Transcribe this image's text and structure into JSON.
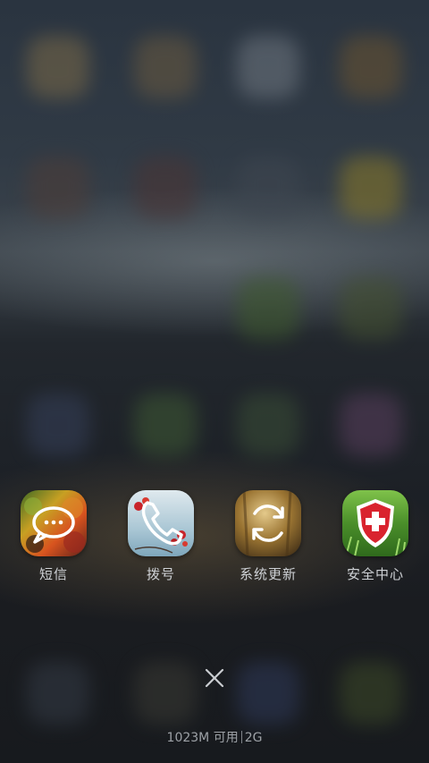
{
  "apps": [
    {
      "label": "短信",
      "icon": "message-bubble-icon"
    },
    {
      "label": "拨号",
      "icon": "phone-handset-icon"
    },
    {
      "label": "系统更新",
      "icon": "refresh-icon"
    },
    {
      "label": "安全中心",
      "icon": "shield-plus-icon"
    }
  ],
  "close": {
    "icon": "close-icon"
  },
  "memory": {
    "available": "1023M 可用",
    "total": "2G"
  },
  "colors": {
    "label_text": "#cfd2d6",
    "memory_text": "#9da1a6",
    "shield_red": "#d9232e"
  }
}
